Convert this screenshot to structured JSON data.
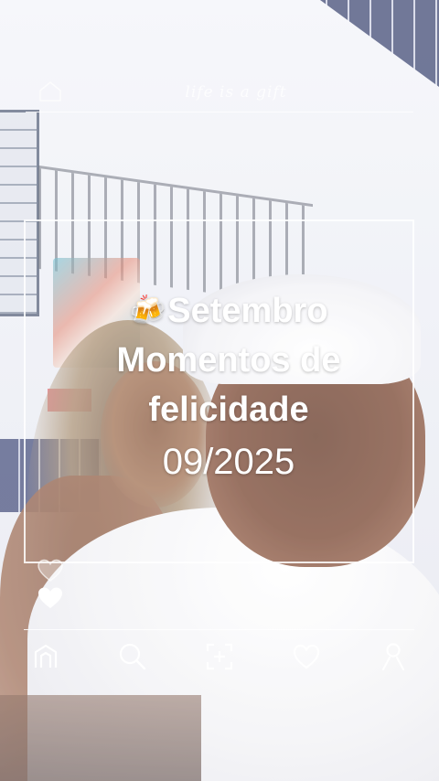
{
  "overlay": {
    "header_script": "life is a gift",
    "caption": {
      "emoji": "🍻",
      "line1": "Setembro",
      "line2": "Momentos de",
      "line3": "felicidade",
      "date": "09/2025"
    }
  },
  "icons": {
    "header": "home-outline-icon",
    "side": [
      "heart-outline-icon",
      "heart-filled-icon"
    ],
    "nav": [
      "home-icon",
      "search-icon",
      "add-frame-icon",
      "heart-icon",
      "profile-icon"
    ]
  },
  "colors": {
    "overlay_white": "#ffffff",
    "tile_blue": "#2b3566"
  }
}
